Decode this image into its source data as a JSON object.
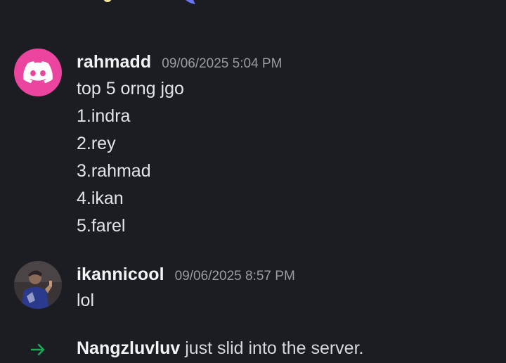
{
  "colors": {
    "background": "#1c1d22",
    "discord_avatar_bg": "#eb459f",
    "join_arrow": "#23a55a",
    "timestamp": "#9a9ca4"
  },
  "messages": [
    {
      "username": "rahmadd",
      "timestamp": "09/06/2025 5:04 PM",
      "avatar_icon": "discord-logo-icon",
      "lines": [
        "top 5 orng jgo",
        "1.indra",
        "2.rey",
        "3.rahmad",
        "4.ikan",
        "5.farel"
      ]
    },
    {
      "username": "ikannicool",
      "timestamp": "09/06/2025 8:57 PM",
      "avatar_icon": "user-photo",
      "lines": [
        "lol"
      ]
    }
  ],
  "system_message": {
    "icon": "join-arrow-icon",
    "username": "Nangzluvluv",
    "text": " just slid into the server."
  }
}
